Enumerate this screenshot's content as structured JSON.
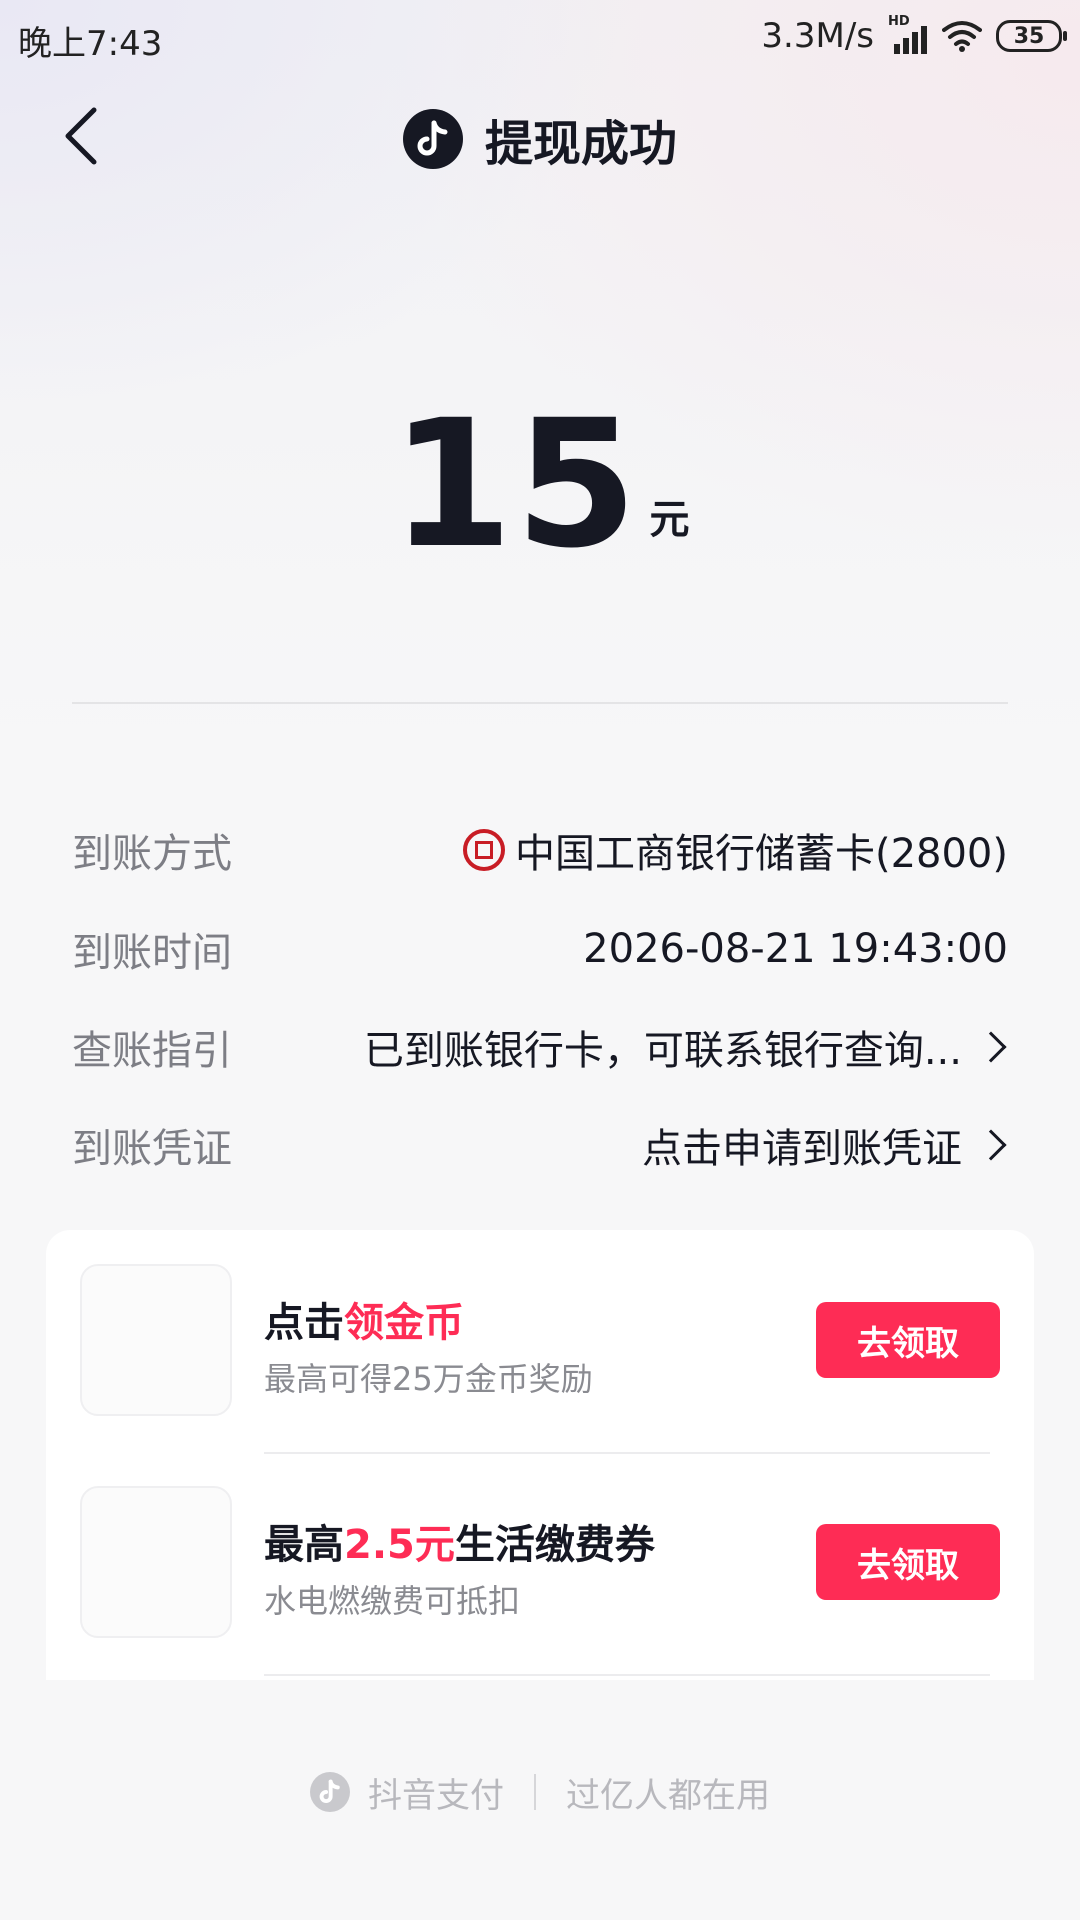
{
  "status_bar": {
    "time": "晚上7:43",
    "speed": "3.3M/s",
    "network_badge": "HD",
    "battery": "35"
  },
  "header": {
    "title": "提现成功",
    "logo_icon": "douyin-logo-icon",
    "back_icon": "chevron-left-icon"
  },
  "amount": {
    "value": "15",
    "unit": "元"
  },
  "details": [
    {
      "label": "到账方式",
      "value": "中国工商银行储蓄卡(2800)",
      "icon": "icbc-bank-icon"
    },
    {
      "label": "到账时间",
      "value": "2026-08-21 19:43:00"
    },
    {
      "label": "查账指引",
      "value": "已到账银行卡，可联系银行查询...",
      "icon": "chevron-right-icon"
    },
    {
      "label": "到账凭证",
      "value": "点击申请到账凭证",
      "icon": "chevron-right-icon"
    }
  ],
  "promos": [
    {
      "title_prefix": "点击",
      "title_highlight": "领金币",
      "title_suffix": "",
      "subtitle": "最高可得25万金币奖励",
      "button": "去领取"
    },
    {
      "title_prefix": "最高",
      "title_highlight": "2.5元",
      "title_suffix": "生活缴费券",
      "subtitle": "水电燃缴费可抵扣",
      "button": "去领取"
    }
  ],
  "footer": {
    "brand": "抖音支付",
    "slogan": "过亿人都在用"
  },
  "colors": {
    "accent": "#fe2c55",
    "text_primary": "#161823",
    "text_secondary": "#7d7e85",
    "bank_red": "#c81d25"
  }
}
